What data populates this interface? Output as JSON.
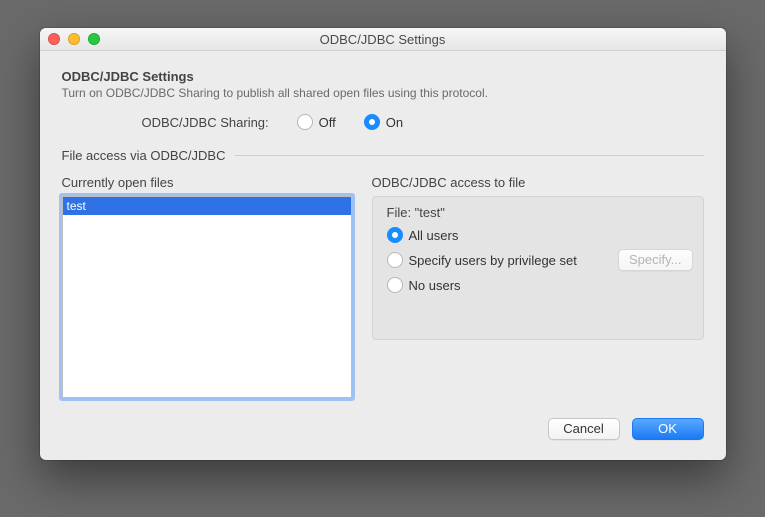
{
  "window": {
    "title": "ODBC/JDBC Settings"
  },
  "section": {
    "title": "ODBC/JDBC Settings",
    "subtitle": "Turn on ODBC/JDBC Sharing to publish all shared open files using this protocol."
  },
  "sharing": {
    "label": "ODBC/JDBC Sharing:",
    "off_label": "Off",
    "on_label": "On",
    "value": "on"
  },
  "file_access_title": "File access via ODBC/JDBC",
  "files": {
    "label": "Currently open files",
    "items": [
      "test"
    ],
    "selected_index": 0
  },
  "access": {
    "group_title": "ODBC/JDBC access to file",
    "file_label_prefix": "File: ",
    "file_name": "test",
    "options": {
      "all_users": "All users",
      "specify": "Specify users by privilege set",
      "no_users": "No users"
    },
    "selected": "all_users",
    "specify_button": "Specify..."
  },
  "footer": {
    "cancel": "Cancel",
    "ok": "OK"
  }
}
